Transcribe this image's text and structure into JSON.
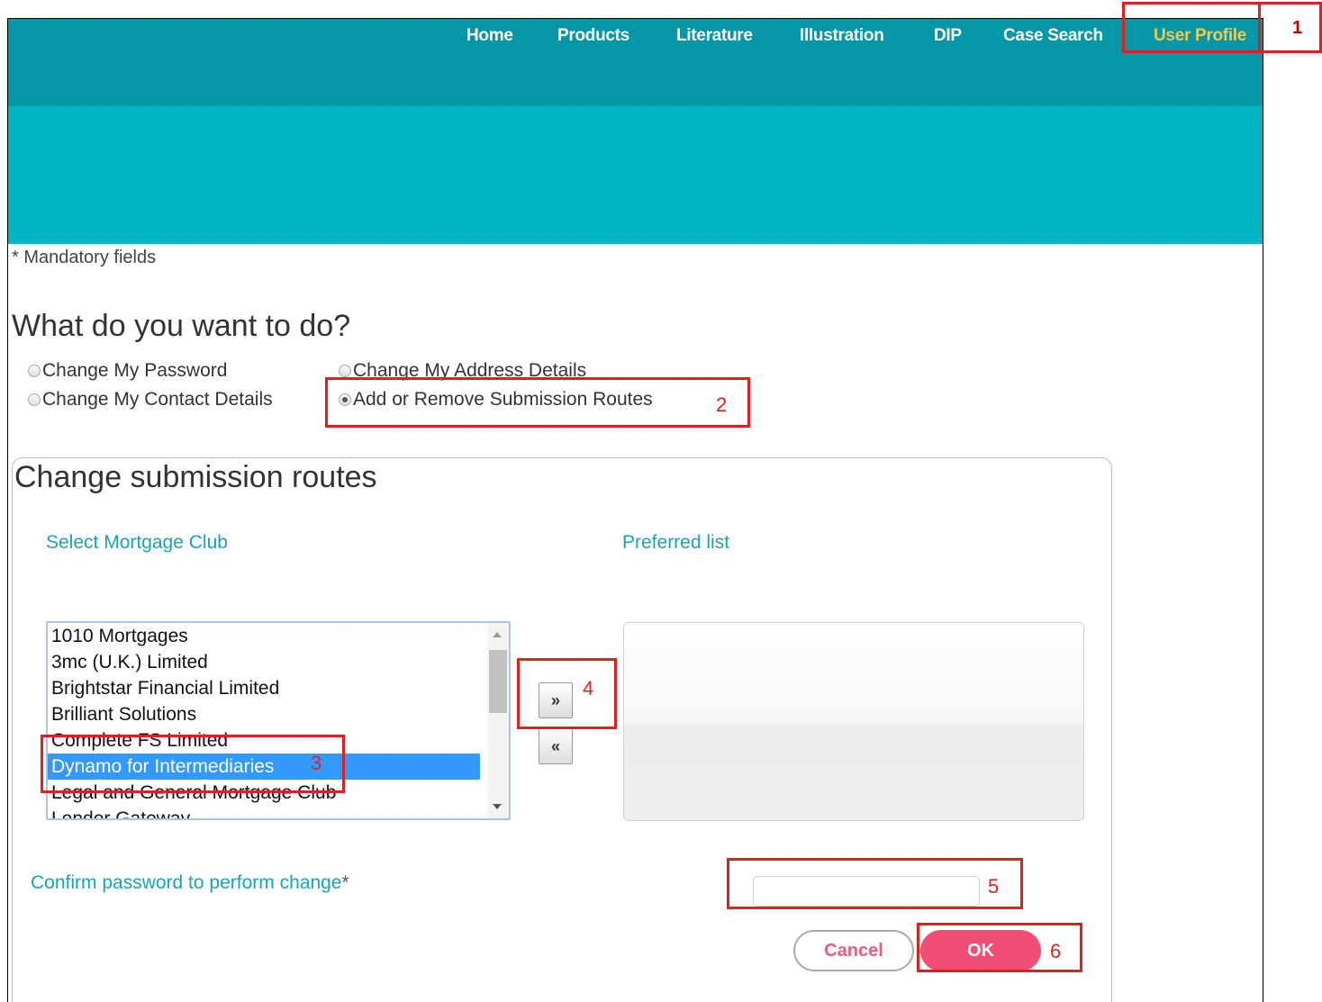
{
  "nav": {
    "items": [
      {
        "label": "Home",
        "active": false
      },
      {
        "label": "Products",
        "active": false
      },
      {
        "label": "Literature",
        "active": false
      },
      {
        "label": "Illustration",
        "active": false
      },
      {
        "label": "DIP",
        "active": false
      },
      {
        "label": "Case Search",
        "active": false
      },
      {
        "label": "User Profile",
        "active": true
      }
    ]
  },
  "mandatory_note": "* Mandatory fields",
  "question": "What do you want to do?",
  "options": [
    {
      "label": "Change My Password",
      "checked": false
    },
    {
      "label": "Change My Address Details",
      "checked": false
    },
    {
      "label": "Change My Contact Details",
      "checked": false
    },
    {
      "label": "Add or Remove Submission Routes",
      "checked": true
    }
  ],
  "panel": {
    "title": "Change submission routes",
    "select_label": "Select Mortgage Club",
    "preferred_label": "Preferred list",
    "clubs": [
      {
        "name": "1010 Mortgages",
        "selected": false
      },
      {
        "name": "3mc (U.K.) Limited",
        "selected": false
      },
      {
        "name": "Brightstar Financial Limited",
        "selected": false
      },
      {
        "name": "Brilliant Solutions",
        "selected": false
      },
      {
        "name": "Complete FS Limited",
        "selected": false
      },
      {
        "name": "Dynamo for Intermediaries",
        "selected": true
      },
      {
        "name": "Legal and General Mortgage Club",
        "selected": false
      },
      {
        "name": "Lender Gateway",
        "selected": false
      }
    ],
    "add_button": "»",
    "remove_button": "«",
    "confirm_label": "Confirm password to perform change",
    "confirm_star": "*",
    "password_value": "",
    "cancel_label": "Cancel",
    "ok_label": "OK"
  },
  "annotations": [
    "1",
    "2",
    "3",
    "4",
    "5",
    "6"
  ],
  "colors": {
    "nav_bg": "#0596a8",
    "banner_bg": "#00b5c4",
    "active_nav": "#f2c94c",
    "teal_text": "#1aa3b3",
    "ok_button": "#f04e74",
    "callout": "#e0201f"
  }
}
